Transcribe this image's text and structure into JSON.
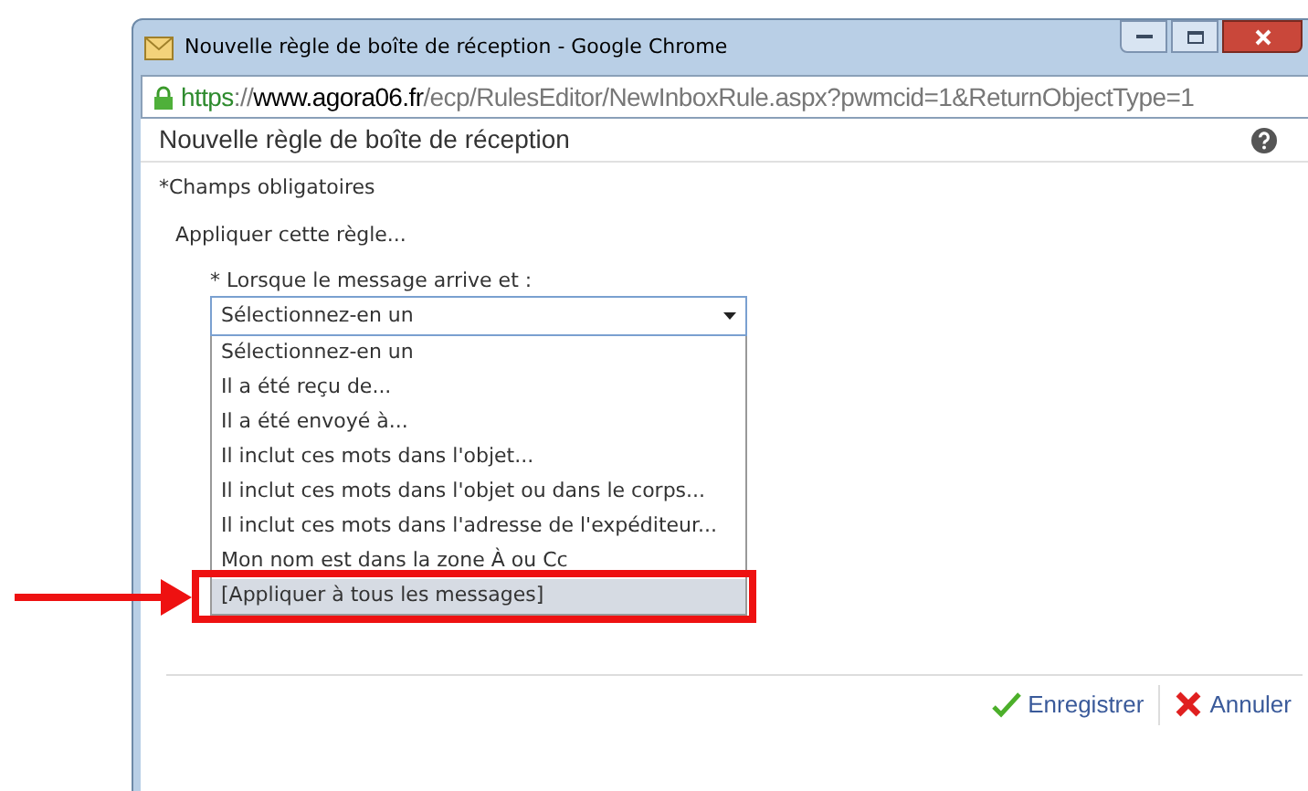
{
  "window": {
    "title": "Nouvelle règle de boîte de réception - Google Chrome"
  },
  "address_bar": {
    "scheme": "https",
    "separator": "://",
    "domain": "www.agora06.fr",
    "path": "/ecp/RulesEditor/NewInboxRule.aspx?pwmcid=1&ReturnObjectType=1"
  },
  "page": {
    "title": "Nouvelle règle de boîte de réception",
    "required_note": "*Champs obligatoires",
    "section": "Appliquer cette règle...",
    "field_label": "* Lorsque le message arrive et :",
    "select_value": "Sélectionnez-en un",
    "options": [
      {
        "label": "Sélectionnez-en un",
        "selected": false
      },
      {
        "label": "Il a été reçu de...",
        "selected": false
      },
      {
        "label": "Il a été envoyé à...",
        "selected": false
      },
      {
        "label": "Il inclut ces mots dans l'objet...",
        "selected": false
      },
      {
        "label": "Il inclut ces mots dans l'objet ou dans le corps...",
        "selected": false
      },
      {
        "label": "Il inclut ces mots dans l'adresse de l'expéditeur...",
        "selected": false
      },
      {
        "label": "Mon nom est dans la zone À ou Cc",
        "selected": false
      },
      {
        "label": "[Appliquer à tous les messages]",
        "selected": true
      }
    ]
  },
  "buttons": [
    {
      "kind": "save",
      "label": "Enregistrer"
    },
    {
      "kind": "cancel",
      "label": "Annuler"
    }
  ]
}
